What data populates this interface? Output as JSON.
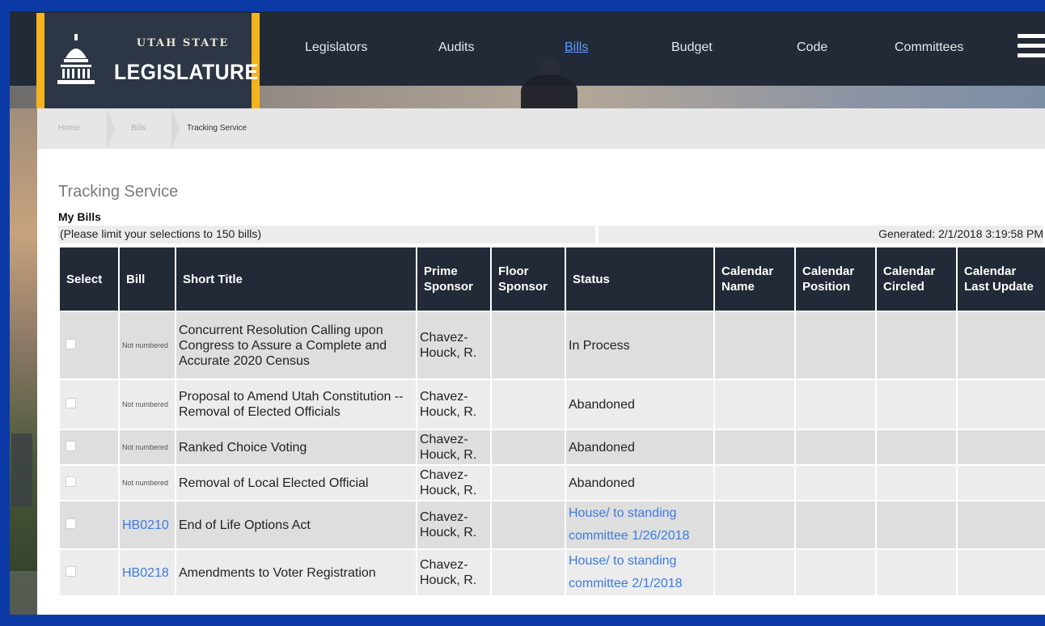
{
  "logo": {
    "line1": "UTAH STATE",
    "line2": "LEGISLATURE"
  },
  "nav": {
    "items": [
      {
        "label": "Legislators",
        "active": false
      },
      {
        "label": "Audits",
        "active": false
      },
      {
        "label": "Bills",
        "active": true
      },
      {
        "label": "Budget",
        "active": false
      },
      {
        "label": "Code",
        "active": false
      },
      {
        "label": "Committees",
        "active": false
      }
    ],
    "menu_icon": "hamburger-menu-icon"
  },
  "breadcrumb": {
    "home": "Home",
    "bills": "Bills",
    "current": "Tracking Service"
  },
  "page": {
    "title": "Tracking Service",
    "section": "My Bills",
    "limit_note": "(Please limit your selections to 150 bills)",
    "generated": "Generated: 2/1/2018 3:19:58 PM"
  },
  "table": {
    "headers": {
      "select": "Select",
      "bill": "Bill",
      "short_title": "Short Title",
      "prime_sponsor": "Prime Sponsor",
      "floor_sponsor": "Floor Sponsor",
      "status": "Status",
      "calendar_name": "Calendar Name",
      "calendar_position": "Calendar Position",
      "calendar_circled": "Calendar Circled",
      "calendar_last_update": "Calendar Last Update"
    },
    "rows": [
      {
        "bill": "Not numbered",
        "title": "Concurrent Resolution Calling upon Congress to Assure a Complete and Accurate 2020 Census",
        "prime": "Chavez-Houck, R.",
        "floor": "",
        "status": "In Process",
        "cal_name": "",
        "cal_pos": "",
        "cal_circled": "",
        "cal_update": ""
      },
      {
        "bill": "Not numbered",
        "title": "Proposal to Amend Utah Constitution -- Removal of Elected Officials",
        "prime": "Chavez-Houck, R.",
        "floor": "",
        "status": "Abandoned",
        "cal_name": "",
        "cal_pos": "",
        "cal_circled": "",
        "cal_update": ""
      },
      {
        "bill": "Not numbered",
        "title": "Ranked Choice Voting",
        "prime": "Chavez-Houck, R.",
        "floor": "",
        "status": "Abandoned",
        "cal_name": "",
        "cal_pos": "",
        "cal_circled": "",
        "cal_update": ""
      },
      {
        "bill": "Not numbered",
        "title": "Removal of Local Elected Official",
        "prime": "Chavez-Houck, R.",
        "floor": "",
        "status": "Abandoned",
        "cal_name": "",
        "cal_pos": "",
        "cal_circled": "",
        "cal_update": ""
      },
      {
        "bill": "HB0210",
        "title": "End of Life Options Act",
        "prime": "Chavez-Houck, R.",
        "floor": "",
        "status": "House/ to standing committee 1/26/2018",
        "cal_name": "",
        "cal_pos": "",
        "cal_circled": "",
        "cal_update": ""
      },
      {
        "bill": "HB0218",
        "title": "Amendments to Voter Registration",
        "prime": "Chavez-Houck, R.",
        "floor": "",
        "status": "House/ to standing committee 2/1/2018",
        "cal_name": "",
        "cal_pos": "",
        "cal_circled": "",
        "cal_update": ""
      }
    ]
  },
  "colors": {
    "nav_bg": "#222a37",
    "accent_gold": "#f5b41e",
    "link_blue": "#3b7be0",
    "frame_blue": "#0b3aa6"
  }
}
